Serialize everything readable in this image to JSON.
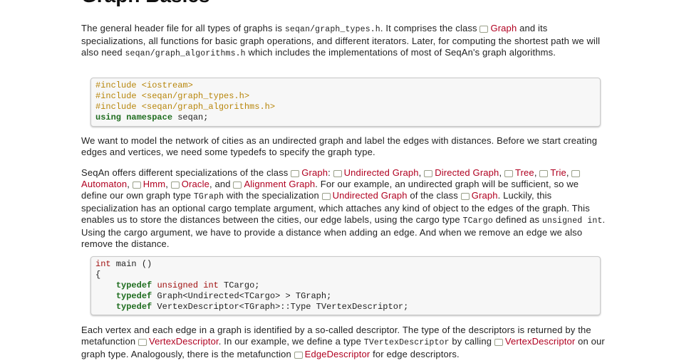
{
  "heading": "Graph Basics",
  "p1": {
    "t1": "The general header file for all types of graphs is ",
    "c1": "seqan/graph_types.h",
    "t2": ". It comprises the class ",
    "l1": "Graph",
    "t3": " and its specializations, all functions for basic graph operations, and different iterators. Later, for computing the shortest path we will also need ",
    "c2": "seqan/graph_algorithms.h",
    "t4": " which includes the implementations of most of SeqAn's graph algorithms."
  },
  "code1": {
    "inc1": "#include <iostream>",
    "inc2": "#include <seqan/graph_types.h>",
    "inc3": "#include <seqan/graph_algorithms.h>",
    "using_kw": "using namespace",
    "using_rest": " seqan;"
  },
  "p2": "We want to model the network of cities as an undirected graph and label the edges with distances. Before we start creating edges and vertices, we need some typedefs to specify the graph type.",
  "p3": {
    "t1": "SeqAn offers different specializations of the class ",
    "l_graph": "Graph",
    "t2": ": ",
    "l_undirected": "Undirected Graph",
    "t3": ", ",
    "l_directed": "Directed Graph",
    "t4": ", ",
    "l_tree": "Tree",
    "t5": ", ",
    "l_trie": "Trie",
    "t6": ", ",
    "l_automaton": "Automaton",
    "t7": ", ",
    "l_hmm": "Hmm",
    "t8": ", ",
    "l_oracle": "Oracle",
    "t9": ", and ",
    "l_alignment": "Alignment Graph",
    "t10": ". For our example, an undirected graph will be sufficient, so we define our own graph type ",
    "c_tgraph": "TGraph",
    "t11": " with the specialization ",
    "l_undirected2": "Undirected Graph",
    "t12": " of the class ",
    "l_graph2": "Graph",
    "t13": ". Luckily, this specialization has an optional cargo template argument, which attaches any kind of object to the edges of the graph. This enables us to store the distances between the cities, our edge labels, using the cargo type ",
    "c_tcargo": "TCargo",
    "t14": " defined as ",
    "c_unsigned": "unsigned int",
    "t15": ". Using the cargo argument, we have to provide a distance when adding an edge. And when we remove an edge we also remove the distance."
  },
  "code2": {
    "int_kw": "int",
    "main_rest": " main ()",
    "brace": "{",
    "indent": "    ",
    "typedef_kw": "typedef",
    "l1_type": "unsigned int",
    "l1_rest": " TCargo;",
    "l2_rest": " Graph<Undirected<TCargo> > TGraph;",
    "l3_rest": " VertexDescriptor<TGraph>::Type TVertexDescriptor;"
  },
  "p4": {
    "t1": "Each vertex and each edge in a graph is identified by a so-called descriptor. The type of the descriptors is returned by the metafunction ",
    "l_vd": "VertexDescriptor",
    "t2": ". In our example, we define a type ",
    "c_tvd": "TVertexDescriptor",
    "t3": " by calling ",
    "l_vd2": "VertexDescriptor",
    "t4": " on our graph type. Analogously, there is the metafunction ",
    "l_ed": "EdgeDescriptor",
    "t5": " for edge descriptors."
  }
}
